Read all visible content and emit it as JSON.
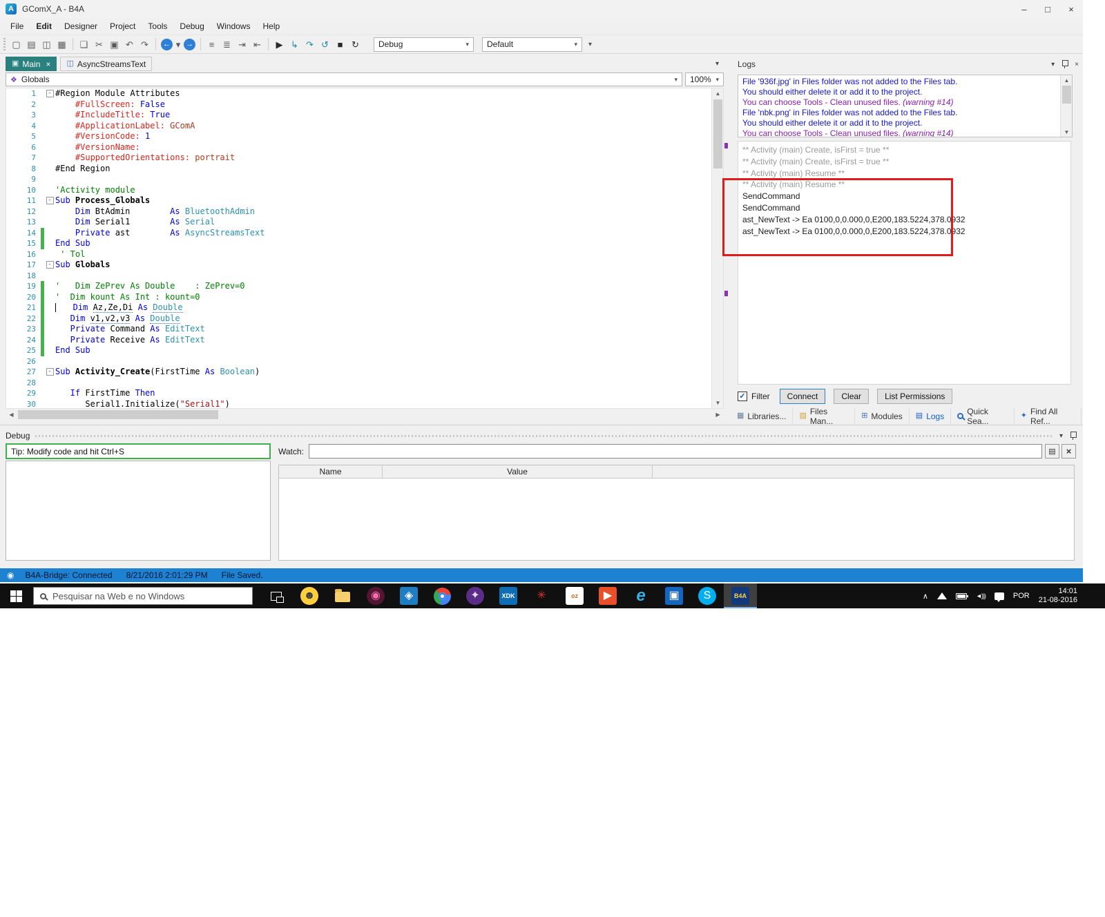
{
  "glyphs": {
    "minimize": "–",
    "maximize": "□",
    "close": "×",
    "dropdown": "▾",
    "up": "▲",
    "down": "▼",
    "left": "◀",
    "right": "▶",
    "check": "✓",
    "fold": "-",
    "chevron_up": "∧",
    "volume": "◄)))",
    "list": "▤",
    "scope": "❖",
    "status": "◉",
    "app_initial": "A"
  },
  "window": {
    "title": "GComX_A - B4A"
  },
  "menubar": {
    "items": [
      "File",
      "Edit",
      "Designer",
      "Project",
      "Tools",
      "Debug",
      "Windows",
      "Help"
    ]
  },
  "toolbar": {
    "mode_dropdown": "Debug",
    "config_dropdown": "Default",
    "icons": [
      {
        "name": "new-file-icon",
        "glyph": "▢"
      },
      {
        "name": "open-icon",
        "glyph": "▤"
      },
      {
        "name": "save-icon",
        "glyph": "◫"
      },
      {
        "name": "save-all-icon",
        "glyph": "▦"
      },
      {
        "sep": true
      },
      {
        "name": "designer-icon",
        "glyph": "❏"
      },
      {
        "name": "cut-icon",
        "glyph": "✂"
      },
      {
        "name": "copy-icon",
        "glyph": "▣"
      },
      {
        "name": "undo-icon",
        "glyph": "↶"
      },
      {
        "name": "redo-ic on",
        "glyph": "↷"
      },
      {
        "sep": true
      },
      {
        "name": "navigate-back-icon",
        "glyph": "←",
        "circle": "#2f7fd6"
      },
      {
        "name": "back-history-icon",
        "glyph": "▾",
        "small": true
      },
      {
        "name": "navigate-forward-icon",
        "glyph": "→",
        "circle": "#2f7fd6"
      },
      {
        "sep": true
      },
      {
        "name": "comment-icon",
        "glyph": "≡"
      },
      {
        "name": "uncomment-icon",
        "glyph": "≣"
      },
      {
        "name": "indent-icon",
        "glyph": "⇥"
      },
      {
        "name": "outdent-icon",
        "glyph": "⇤"
      },
      {
        "sep": true
      },
      {
        "name": "run-icon",
        "glyph": "▶",
        "color": "#2a2a2a"
      },
      {
        "name": "step-into-icon",
        "glyph": "↳",
        "color": "#1b8f9e"
      },
      {
        "name": "step-over-icon",
        "glyph": "↷",
        "color": "#1b8f9e"
      },
      {
        "name": "step-out-icon",
        "glyph": "↺",
        "color": "#1b8f9e"
      },
      {
        "name": "stop-icon",
        "glyph": "■",
        "color": "#2a2a2a"
      },
      {
        "name": "restart-icon",
        "glyph": "↻",
        "color": "#2a2a2a"
      }
    ]
  },
  "editor": {
    "tabs": [
      {
        "label": "Main",
        "glyph": "▣",
        "icon": "form-icon",
        "active": true
      },
      {
        "label": "AsyncStreamsText",
        "glyph": "◫",
        "icon": "code-module-icon",
        "active": false
      }
    ],
    "scope_dropdown": "Globals",
    "zoom": "100%",
    "lines": [
      {
        "n": 1,
        "fold": true,
        "seg": [
          [
            "p",
            "#Region Module Attributes"
          ]
        ]
      },
      {
        "n": 2,
        "seg": [
          [
            "a",
            "    #FullScreen:"
          ],
          [
            "k",
            " False"
          ]
        ]
      },
      {
        "n": 3,
        "seg": [
          [
            "a",
            "    #IncludeTitle:"
          ],
          [
            "k",
            " True"
          ]
        ]
      },
      {
        "n": 4,
        "seg": [
          [
            "a",
            "    #ApplicationLabel:"
          ],
          [
            "v",
            " GComA"
          ]
        ]
      },
      {
        "n": 5,
        "seg": [
          [
            "a",
            "    #VersionCode:"
          ],
          [
            "k",
            " 1"
          ]
        ]
      },
      {
        "n": 6,
        "seg": [
          [
            "a",
            "    #VersionName:"
          ]
        ]
      },
      {
        "n": 7,
        "seg": [
          [
            "a",
            "    #SupportedOrientations:"
          ],
          [
            "v",
            " portrait"
          ]
        ]
      },
      {
        "n": 8,
        "seg": [
          [
            "p",
            "#End Region"
          ]
        ]
      },
      {
        "n": 9,
        "seg": []
      },
      {
        "n": 10,
        "seg": [
          [
            "c",
            "'Activity module"
          ]
        ]
      },
      {
        "n": 11,
        "fold": true,
        "seg": [
          [
            "k",
            "Sub "
          ],
          [
            "b",
            "Process_Globals"
          ]
        ]
      },
      {
        "n": 12,
        "seg": [
          [
            "k",
            "    Dim "
          ],
          [
            "p",
            "BtAdmin        "
          ],
          [
            "k",
            "As "
          ],
          [
            "t",
            "BluetoothAdmin"
          ]
        ]
      },
      {
        "n": 13,
        "seg": [
          [
            "k",
            "    Dim "
          ],
          [
            "p",
            "Serial1        "
          ],
          [
            "k",
            "As "
          ],
          [
            "t",
            "Serial"
          ]
        ]
      },
      {
        "n": 14,
        "bar": true,
        "seg": [
          [
            "k",
            "    Private "
          ],
          [
            "p",
            "ast        "
          ],
          [
            "k",
            "As "
          ],
          [
            "t",
            "AsyncStreamsText"
          ]
        ]
      },
      {
        "n": 15,
        "bar": true,
        "seg": [
          [
            "k",
            "End Sub"
          ]
        ]
      },
      {
        "n": 16,
        "seg": [
          [
            "c",
            " ' Tol"
          ]
        ]
      },
      {
        "n": 17,
        "fold": true,
        "seg": [
          [
            "k",
            "Sub "
          ],
          [
            "b",
            "Globals"
          ]
        ]
      },
      {
        "n": 18,
        "seg": []
      },
      {
        "n": 19,
        "bar": true,
        "seg": [
          [
            "c",
            "'   Dim ZePrev As Double    : ZePrev=0"
          ]
        ]
      },
      {
        "n": 20,
        "bar": true,
        "seg": [
          [
            "c",
            "'  Dim kount As Int : kount=0"
          ]
        ]
      },
      {
        "n": 21,
        "bar": true,
        "cursor": true,
        "seg": [
          [
            "k",
            "   Dim "
          ],
          [
            "pw",
            "Az,Ze,Di"
          ],
          [
            "k",
            " As "
          ],
          [
            "tw",
            "Double"
          ]
        ]
      },
      {
        "n": 22,
        "bar": true,
        "seg": [
          [
            "k",
            "   Dim "
          ],
          [
            "pw",
            "v1,v2,v3"
          ],
          [
            "k",
            " As "
          ],
          [
            "tw",
            "Double"
          ]
        ]
      },
      {
        "n": 23,
        "bar": true,
        "seg": [
          [
            "k",
            "   Private "
          ],
          [
            "p",
            "Command "
          ],
          [
            "k",
            "As "
          ],
          [
            "t",
            "EditText"
          ]
        ]
      },
      {
        "n": 24,
        "bar": true,
        "seg": [
          [
            "k",
            "   Private "
          ],
          [
            "p",
            "Receive "
          ],
          [
            "k",
            "As "
          ],
          [
            "t",
            "EditText"
          ]
        ]
      },
      {
        "n": 25,
        "bar": true,
        "seg": [
          [
            "k",
            "End Sub"
          ]
        ]
      },
      {
        "n": 26,
        "seg": []
      },
      {
        "n": 27,
        "fold": true,
        "seg": [
          [
            "k",
            "Sub "
          ],
          [
            "b",
            "Activity_Create"
          ],
          [
            "p",
            "(FirstTime "
          ],
          [
            "k",
            "As "
          ],
          [
            "t",
            "Boolean"
          ],
          [
            "p",
            ")"
          ]
        ]
      },
      {
        "n": 28,
        "seg": []
      },
      {
        "n": 29,
        "seg": [
          [
            "k",
            "   If "
          ],
          [
            "p",
            "FirstTime "
          ],
          [
            "k",
            "Then"
          ]
        ]
      },
      {
        "n": 30,
        "seg": [
          [
            "p",
            "      Serial1.Initialize("
          ],
          [
            "s",
            "\"Serial1\""
          ],
          [
            "p",
            ")"
          ]
        ]
      }
    ]
  },
  "logs": {
    "title": "Logs",
    "filter_label": "Filter",
    "buttons": [
      "Connect",
      "Clear",
      "List Permissions"
    ],
    "warnings": [
      [
        [
          "wb",
          "File '936f.jpg' in Files folder was not added to the Files tab."
        ]
      ],
      [
        [
          "wb",
          "You should either delete it or add it to the project."
        ]
      ],
      [
        [
          "wp",
          "You can choose Tools - Clean unused files. "
        ],
        [
          "wpi",
          "(warning #14)"
        ]
      ],
      [
        [
          "wb",
          "File 'nbk.png' in Files folder was not added to the Files tab."
        ]
      ],
      [
        [
          "wb",
          "You should either delete it or add it to the project."
        ]
      ],
      [
        [
          "wp",
          "You can choose Tools - Clean unused files. "
        ],
        [
          "wpi",
          "(warning #14)"
        ]
      ]
    ],
    "messages": [
      {
        "text": "** Activity (main) Create, isFirst = true **",
        "color": "gray"
      },
      {
        "text": "** Activity (main) Create, isFirst = true **",
        "color": "gray"
      },
      {
        "text": "** Activity (main) Resume **",
        "color": "gray"
      },
      {
        "text": "** Activity (main) Resume **",
        "color": "gray"
      },
      {
        "text": "SendCommand",
        "color": "black"
      },
      {
        "text": "SendCommand",
        "color": "black"
      },
      {
        "text": "ast_NewText -> Ea 0100,0,0.000,0,E200,183.5224,378.0932",
        "color": "black"
      },
      {
        "text": "ast_NewText -> Ea 0100,0,0.000,0,E200,183.5224,378.0932",
        "color": "black"
      }
    ],
    "tabs": [
      {
        "label": "Libraries...",
        "icon": "libraries-icon",
        "glyph": "▦",
        "color": "#6a7f95"
      },
      {
        "label": "Files Man...",
        "icon": "files-manager-icon",
        "glyph": "▧",
        "color": "#d8a33a"
      },
      {
        "label": "Modules",
        "icon": "modules-icon",
        "glyph": "⊞",
        "color": "#4a6fb5"
      },
      {
        "label": "Logs",
        "icon": "logs-icon",
        "glyph": "▤",
        "color": "#1f5fbf",
        "active": true
      },
      {
        "label": "Quick Sea...",
        "icon": "search-icon",
        "glyph": "MAG",
        "color": "#2b6bc0"
      },
      {
        "label": "Find All Ref...",
        "icon": "find-references-icon",
        "glyph": "✦",
        "color": "#2b6bc0"
      }
    ]
  },
  "debug_panel": {
    "title": "Debug",
    "tip": "Tip: Modify code and hit Ctrl+S",
    "watch_label": "Watch:",
    "watch_value": "",
    "table": {
      "columns": [
        "Name",
        "Value"
      ]
    }
  },
  "statusbar": {
    "bridge": "B4A-Bridge: Connected",
    "timestamp": "8/21/2016 2:01:29 PM",
    "message": "File Saved."
  },
  "taskbar": {
    "search_placeholder": "Pesquisar na Web e no Windows",
    "language": "POR",
    "time": "14:01",
    "date": "21-08-2016",
    "apps": [
      {
        "name": "chat-app-icon",
        "glyph": "☻",
        "fg": "#3a3a3a",
        "bg": "#ffcf40",
        "shape": "circle"
      },
      {
        "name": "file-explorer-icon",
        "kind": "folder"
      },
      {
        "name": "media-app-icon",
        "glyph": "◉",
        "fg": "#ff6fae",
        "bg": "#511631",
        "shape": "circle"
      },
      {
        "name": "store-app-icon",
        "glyph": "◈",
        "fg": "#ffffff",
        "bg": "#1f7ec2",
        "shape": "square"
      },
      {
        "name": "chrome-icon",
        "kind": "chrome"
      },
      {
        "name": "photo-editor-icon",
        "glyph": "✦",
        "fg": "#e8d9f5",
        "bg": "#5b2d86",
        "shape": "circle"
      },
      {
        "name": "intel-xdk-icon",
        "glyph": "XDK",
        "fg": "#ffffff",
        "bg": "#0f6db6",
        "shape": "square",
        "small": true
      },
      {
        "name": "pinwheel-app-icon",
        "glyph": "✳",
        "fg": "#e03131",
        "shape": "none"
      },
      {
        "name": "outlook-icon",
        "glyph": "oz",
        "fg": "#d2691e",
        "bg": "#ffffff",
        "shape": "square",
        "small": true
      },
      {
        "name": "video-app-icon",
        "glyph": "▶",
        "fg": "#ffffff",
        "bg": "#e8502a",
        "shape": "square"
      },
      {
        "name": "ie-icon",
        "glyph": "e",
        "fg": "#35b2e5",
        "shape": "none",
        "big": true
      },
      {
        "name": "photos-app-icon",
        "glyph": "▣",
        "fg": "#ffffff",
        "bg": "#1565c0",
        "shape": "square"
      },
      {
        "name": "skype-icon",
        "glyph": "S",
        "fg": "#ffffff",
        "bg": "#00aff0",
        "shape": "circle"
      },
      {
        "name": "b4a-icon",
        "glyph": "B4A",
        "fg": "#ffd34d",
        "bg": "#123a7a",
        "shape": "square",
        "small": true,
        "active": true
      }
    ]
  }
}
